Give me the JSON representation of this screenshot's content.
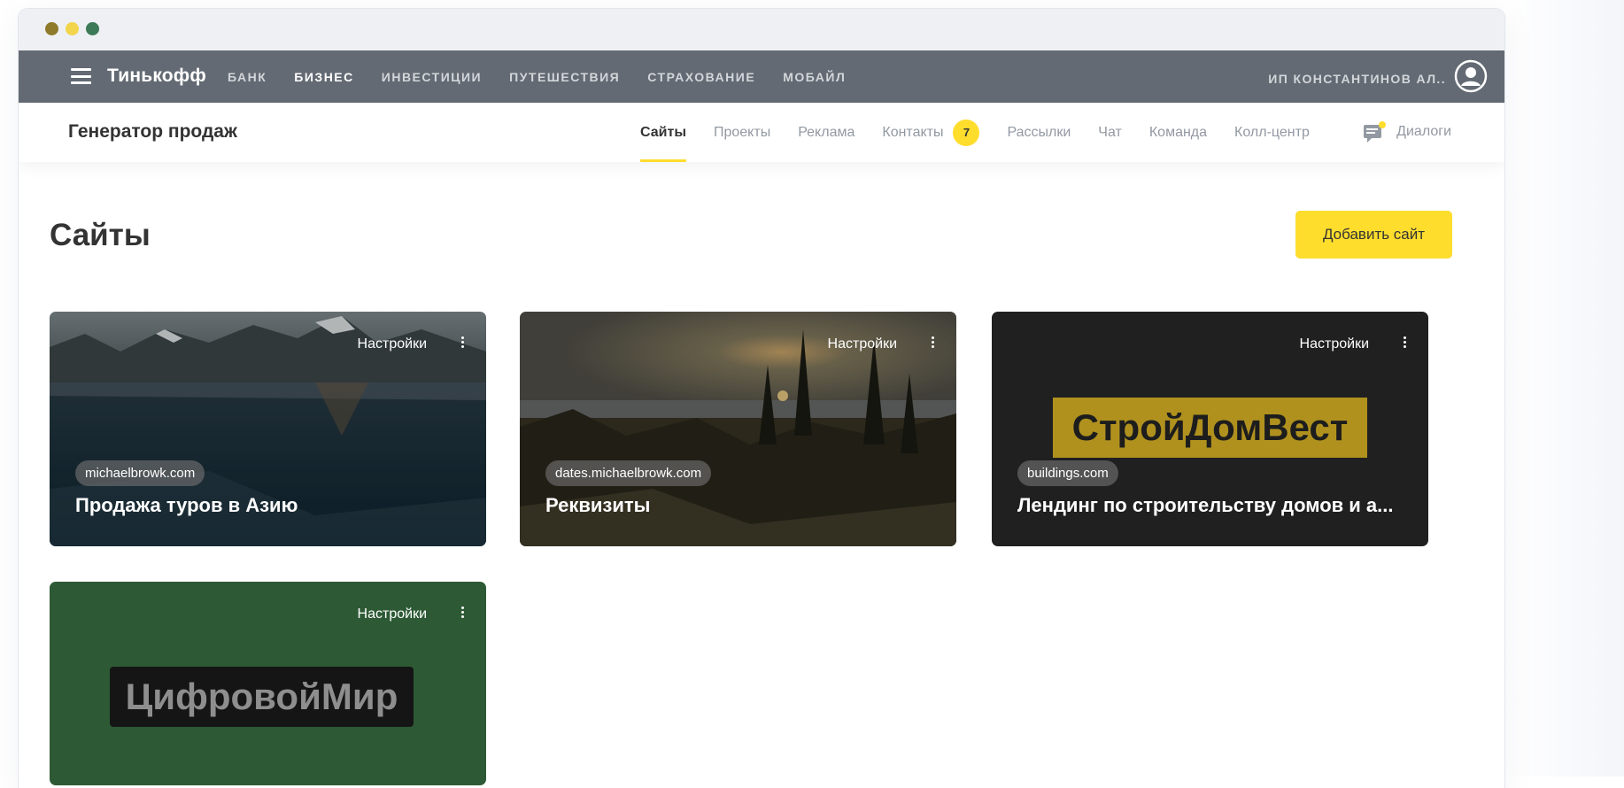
{
  "topnav": {
    "logo": "Тинькофф",
    "links": [
      "БАНК",
      "БИЗНЕС",
      "ИНВЕСТИЦИИ",
      "ПУТЕШЕСТВИЯ",
      "СТРАХОВАНИЕ",
      "МОБАЙЛ"
    ],
    "active_link": "БИЗНЕС",
    "user_name": "ИП КОНСТАНТИНОВ АЛ.."
  },
  "subnav": {
    "product_title": "Генератор продаж",
    "tabs": [
      "Сайты",
      "Проекты",
      "Реклама",
      "Контакты",
      "Рассылки",
      "Чат",
      "Команда",
      "Колл-центр"
    ],
    "active_tab": "Сайты",
    "contacts_badge": "7",
    "dialogs_label": "Диалоги"
  },
  "page": {
    "title": "Сайты",
    "add_button": "Добавить сайт"
  },
  "cards": [
    {
      "settings": "Настройки",
      "domain": "michaelbrowk.com",
      "title": "Продажа туров в Азию"
    },
    {
      "settings": "Настройки",
      "domain": "dates.michaelbrowk.com",
      "title": "Реквизиты"
    },
    {
      "settings": "Настройки",
      "domain": "buildings.com",
      "title": "Лендинг по строительству домов и а...",
      "brand": "СтройДомВест"
    },
    {
      "settings": "Настройки",
      "brand": "ЦифровойМир"
    }
  ],
  "colors": {
    "accent": "#ffdd2d",
    "topnav_bg": "#636a73",
    "card3_bg": "#202020",
    "card4_bg": "#2d5a35"
  }
}
